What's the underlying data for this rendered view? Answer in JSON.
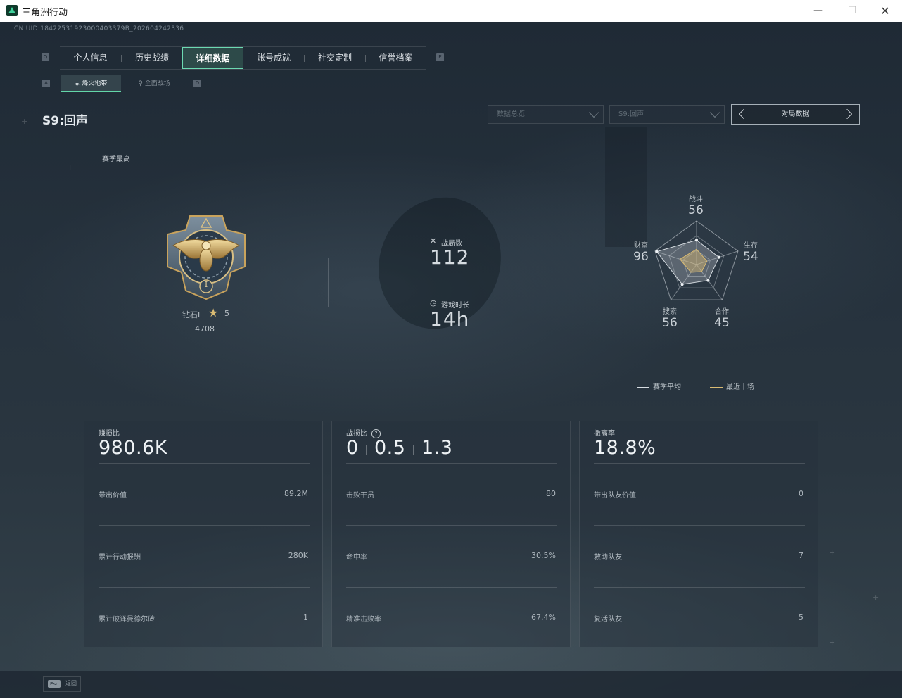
{
  "window": {
    "title": "三角洲行动",
    "minimize": "—",
    "maximize": "☐",
    "close": "✕"
  },
  "uid": "CN UID:18422531923000403379B_202604242336",
  "nav": {
    "left_key": "Q",
    "right_key": "E",
    "tabs": [
      "个人信息",
      "历史战绩",
      "详细数据",
      "账号成就",
      "社交定制",
      "信誉档案"
    ],
    "active_index": 2
  },
  "subnav": {
    "left_key": "A",
    "right_key": "D",
    "tabs": [
      "烽火地带",
      "全面战场"
    ],
    "active_index": 0
  },
  "season": {
    "title": "S9:回声",
    "high_label": "赛季最高"
  },
  "filters": {
    "dropdown1": "数据总览",
    "dropdown2": "S9:回声",
    "pager_label": "对局数据"
  },
  "rank": {
    "name": "钻石I",
    "stars": "5",
    "score": "4708",
    "numeral": "I"
  },
  "stats": {
    "matches_label": "战局数",
    "matches_value": "112",
    "time_label": "游戏时长",
    "time_value": "14h"
  },
  "radar": {
    "axes": [
      {
        "label": "战斗",
        "value": "56"
      },
      {
        "label": "生存",
        "value": "54"
      },
      {
        "label": "合作",
        "value": "45"
      },
      {
        "label": "搜索",
        "value": "56"
      },
      {
        "label": "财富",
        "value": "96"
      }
    ],
    "season_avg": [
      56,
      54,
      45,
      56,
      96
    ],
    "recent_ten": [
      35,
      25,
      20,
      22,
      40
    ],
    "legend_avg": "赛季平均",
    "legend_recent": "最近十场",
    "colors": {
      "avg": "#d6dce1",
      "recent": "#d9bb73"
    }
  },
  "cards": [
    {
      "title": "赚损比",
      "big": "980.6K",
      "rows": [
        {
          "label": "带出价值",
          "value": "89.2M"
        },
        {
          "label": "累计行动报酬",
          "value": "280K"
        },
        {
          "label": "累计破译曼德尔砖",
          "value": "1"
        }
      ]
    },
    {
      "title": "战损比",
      "help": "?",
      "big_parts": [
        "0",
        "0.5",
        "1.3"
      ],
      "rows": [
        {
          "label": "击败干员",
          "value": "80"
        },
        {
          "label": "命中率",
          "value": "30.5%"
        },
        {
          "label": "精准击败率",
          "value": "67.4%"
        }
      ]
    },
    {
      "title": "撤离率",
      "big": "18.8%",
      "rows": [
        {
          "label": "带出队友价值",
          "value": "0"
        },
        {
          "label": "救助队友",
          "value": "7"
        },
        {
          "label": "复活队友",
          "value": "5"
        }
      ]
    }
  ],
  "bottom": {
    "esc_key": "Esc",
    "esc_label": "返回"
  },
  "colors": {
    "accent": "#63d6a9",
    "gold": "#d9bb73"
  }
}
